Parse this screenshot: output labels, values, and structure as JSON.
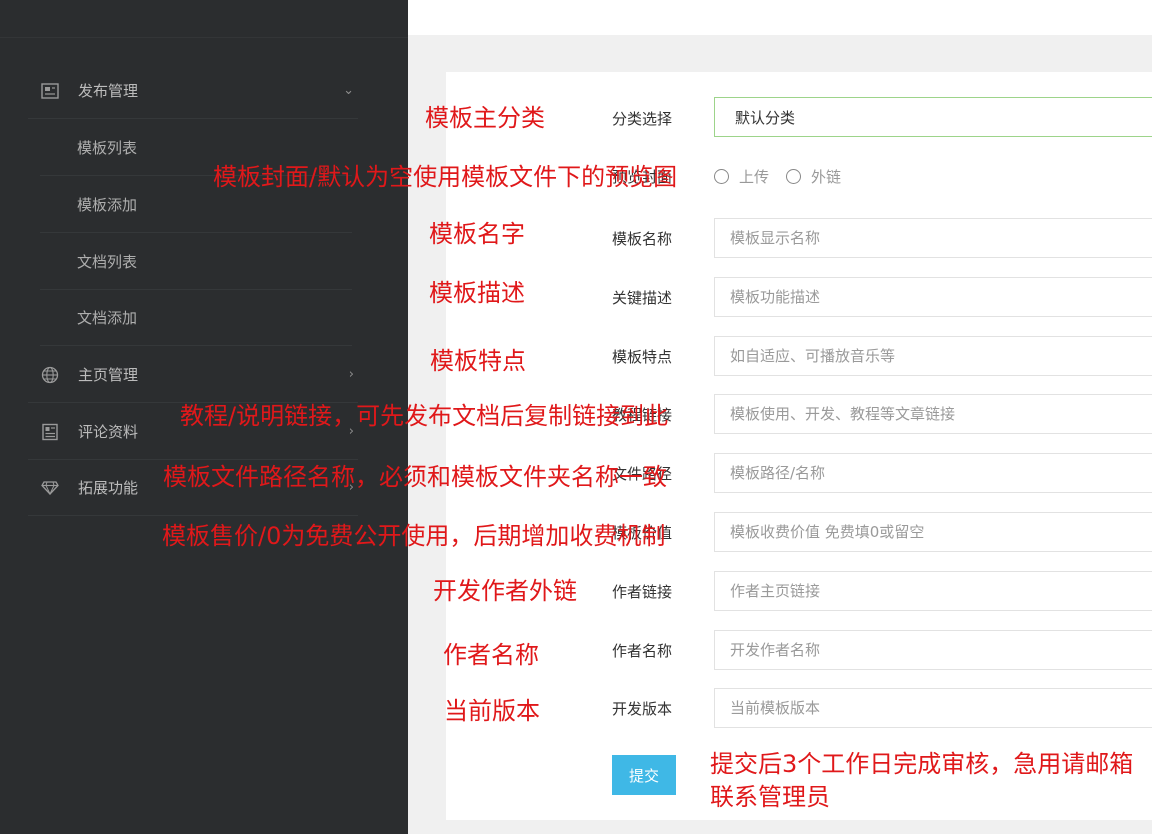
{
  "sidebar": {
    "items": [
      {
        "label": "发布管理",
        "icon": "news-icon",
        "arrow": "⌄"
      },
      {
        "label": "主页管理",
        "icon": "globe-icon",
        "arrow": "›"
      },
      {
        "label": "评论资料",
        "icon": "newspaper-icon",
        "arrow": "›"
      },
      {
        "label": "拓展功能",
        "icon": "diamond-icon",
        "arrow": "›"
      }
    ],
    "sub_items": [
      "模板列表",
      "模板添加",
      "文档列表",
      "文档添加"
    ]
  },
  "form": {
    "category": {
      "label": "分类选择",
      "value": "默认分类"
    },
    "cover": {
      "label": "预览封面",
      "options": [
        "上传",
        "外链"
      ]
    },
    "name": {
      "label": "模板名称",
      "placeholder": "模板显示名称"
    },
    "desc": {
      "label": "关键描述",
      "placeholder": "模板功能描述"
    },
    "features": {
      "label": "模板特点",
      "placeholder": "如自适应、可播放音乐等"
    },
    "tutorial": {
      "label": "教程链接",
      "placeholder": "模板使用、开发、教程等文章链接"
    },
    "path": {
      "label": "文件路径",
      "placeholder": "模板路径/名称"
    },
    "price": {
      "label": "模板价值",
      "placeholder": "模板收费价值 免费填0或留空"
    },
    "author_link": {
      "label": "作者链接",
      "placeholder": "作者主页链接"
    },
    "author_name": {
      "label": "作者名称",
      "placeholder": "开发作者名称"
    },
    "version": {
      "label": "开发版本",
      "placeholder": "当前模板版本"
    },
    "submit": "提交"
  },
  "annotations": {
    "category": "模板主分类",
    "cover": "模板封面/默认为空使用模板文件下的预览图",
    "name": "模板名字",
    "desc": "模板描述",
    "features": "模板特点",
    "tutorial": "教程/说明链接，可先发布文档后复制链接到此",
    "path": "模板文件路径名称，必须和模板文件夹名称一致",
    "price": "模板售价/0为免费公开使用，后期增加收费机制",
    "author_link": "开发作者外链",
    "author_name": "作者名称",
    "version": "当前版本",
    "submit": "提交后3个工作日完成审核，急用请邮箱联系管理员"
  },
  "colors": {
    "sidebar_bg": "#2b2d2f",
    "annotation": "#e0181a",
    "submit_bg": "#3fb8e6",
    "select_border": "#9dd48a"
  }
}
